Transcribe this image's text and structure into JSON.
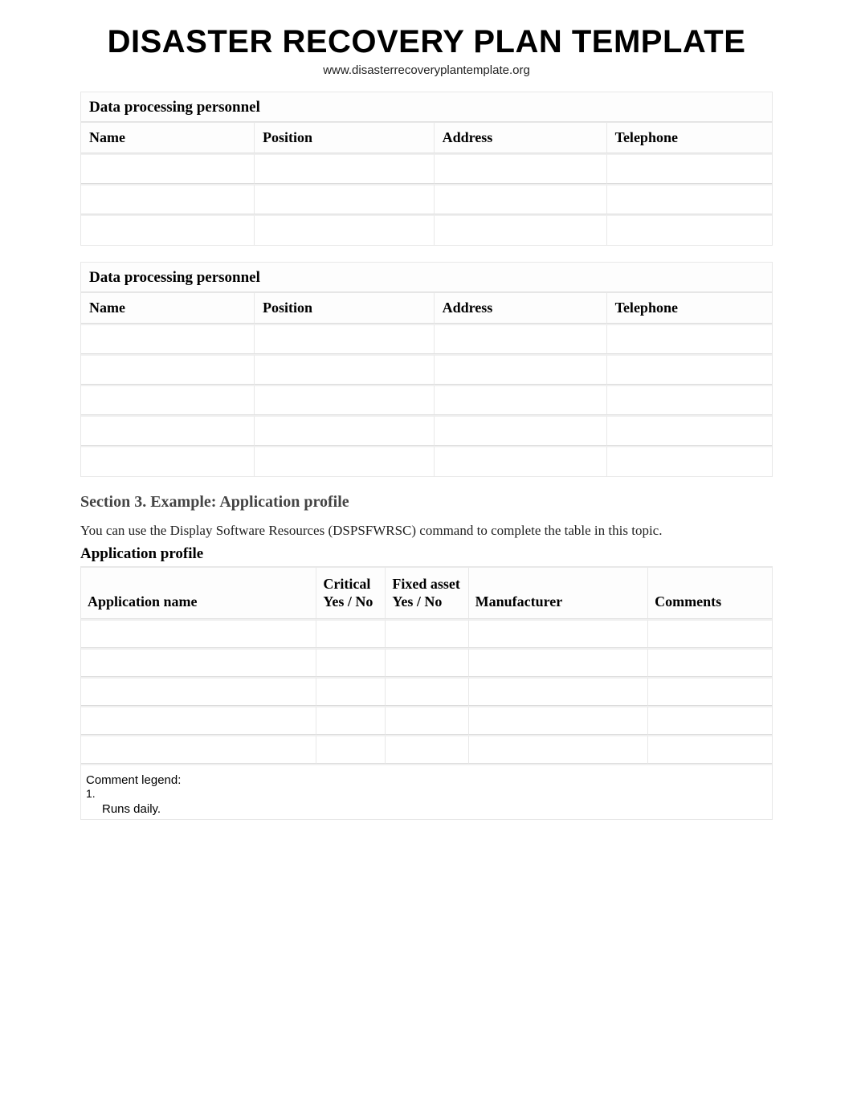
{
  "page": {
    "title": "DISASTER RECOVERY PLAN TEMPLATE",
    "url": "www.disasterrecoveryplantemplate.org"
  },
  "personnel_table_a": {
    "title": "Data processing personnel",
    "columns": [
      "Name",
      "Position",
      "Address",
      "Telephone"
    ],
    "rows": [
      [
        "",
        "",
        "",
        ""
      ],
      [
        "",
        "",
        "",
        ""
      ],
      [
        "",
        "",
        "",
        ""
      ]
    ]
  },
  "personnel_table_b": {
    "title": "Data processing personnel",
    "columns": [
      "Name",
      "Position",
      "Address",
      "Telephone"
    ],
    "rows": [
      [
        "",
        "",
        "",
        ""
      ],
      [
        "",
        "",
        "",
        ""
      ],
      [
        "",
        "",
        "",
        ""
      ],
      [
        "",
        "",
        "",
        ""
      ],
      [
        "",
        "",
        "",
        ""
      ]
    ]
  },
  "section3": {
    "heading": "Section 3. Example: Application profile",
    "text": "You can use the Display Software Resources (DSPSFWRSC) command to complete the table in this topic.",
    "table_title": "Application profile"
  },
  "profile_table": {
    "columns": [
      "Application name",
      "Critical Yes / No",
      "Fixed asset Yes / No",
      "Manufacturer",
      "Comments"
    ],
    "rows": [
      [
        "",
        "",
        "",
        "",
        ""
      ],
      [
        "",
        "",
        "",
        "",
        ""
      ],
      [
        "",
        "",
        "",
        "",
        ""
      ],
      [
        "",
        "",
        "",
        "",
        ""
      ],
      [
        "",
        "",
        "",
        "",
        ""
      ]
    ],
    "legend_title": "Comment legend:",
    "legend": [
      {
        "num": "1.",
        "text": "Runs daily."
      }
    ]
  }
}
